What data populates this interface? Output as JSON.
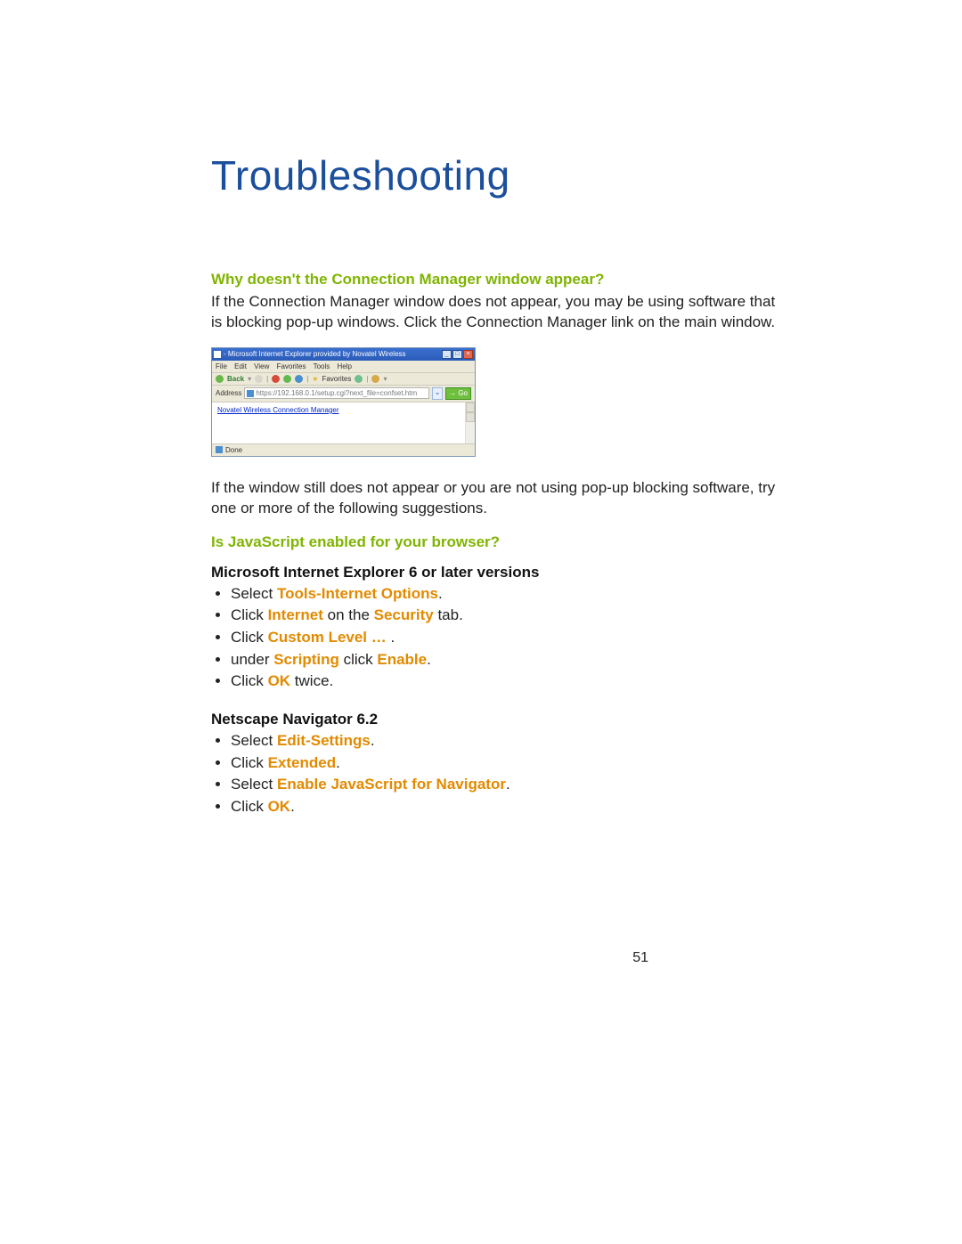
{
  "title": "Troubleshooting",
  "page_number": "51",
  "q1": {
    "heading": "Why doesn't the Connection Manager window appear?",
    "para1": "If the Connection Manager window does not appear, you may be using software that is blocking pop-up windows. Click the Connection Manager link on the main window.",
    "para2": "If the window still does not appear or you are not using pop-up blocking software,  try one or more of the following suggestions."
  },
  "q2": {
    "heading": "Is JavaScript enabled for your browser?",
    "ie_section": {
      "title": "Microsoft Internet Explorer 6 or later versions",
      "steps": [
        {
          "pre": "Select ",
          "hl": "Tools-Internet Options",
          "post": "."
        },
        {
          "pre": "Click ",
          "hl": "Internet",
          "mid": " on the ",
          "hl2": "Security",
          "post": " tab."
        },
        {
          "pre": "Click ",
          "hl": "Custom Level …",
          "post": " ."
        },
        {
          "pre": "under ",
          "hl": "Scripting",
          "mid": " click ",
          "hl2": "Enable",
          "post": "."
        },
        {
          "pre": "Click ",
          "hl": "OK",
          "post": " twice."
        }
      ]
    },
    "nn_section": {
      "title": "Netscape Navigator 6.2",
      "steps": [
        {
          "pre": "Select ",
          "hl": "Edit-Settings",
          "post": "."
        },
        {
          "pre": "Click ",
          "hl": "Extended",
          "post": "."
        },
        {
          "pre": "Select ",
          "hl": "Enable JavaScript for Navigator",
          "post": "."
        },
        {
          "pre": "Click ",
          "hl": "OK",
          "post": "."
        }
      ]
    }
  },
  "ie_mock": {
    "title": "  - Microsoft Internet Explorer provided by Novatel Wireless",
    "menubar": [
      "File",
      "Edit",
      "View",
      "Favorites",
      "Tools",
      "Help"
    ],
    "back_label": "Back",
    "fav_label": "Favorites",
    "address_label": "Address",
    "url": "https://192.168.0.1/setup.cgi?next_file=confset.htm",
    "go_label": "Go",
    "content_link": "Novatel Wireless Connection Manager",
    "status": "Done"
  }
}
